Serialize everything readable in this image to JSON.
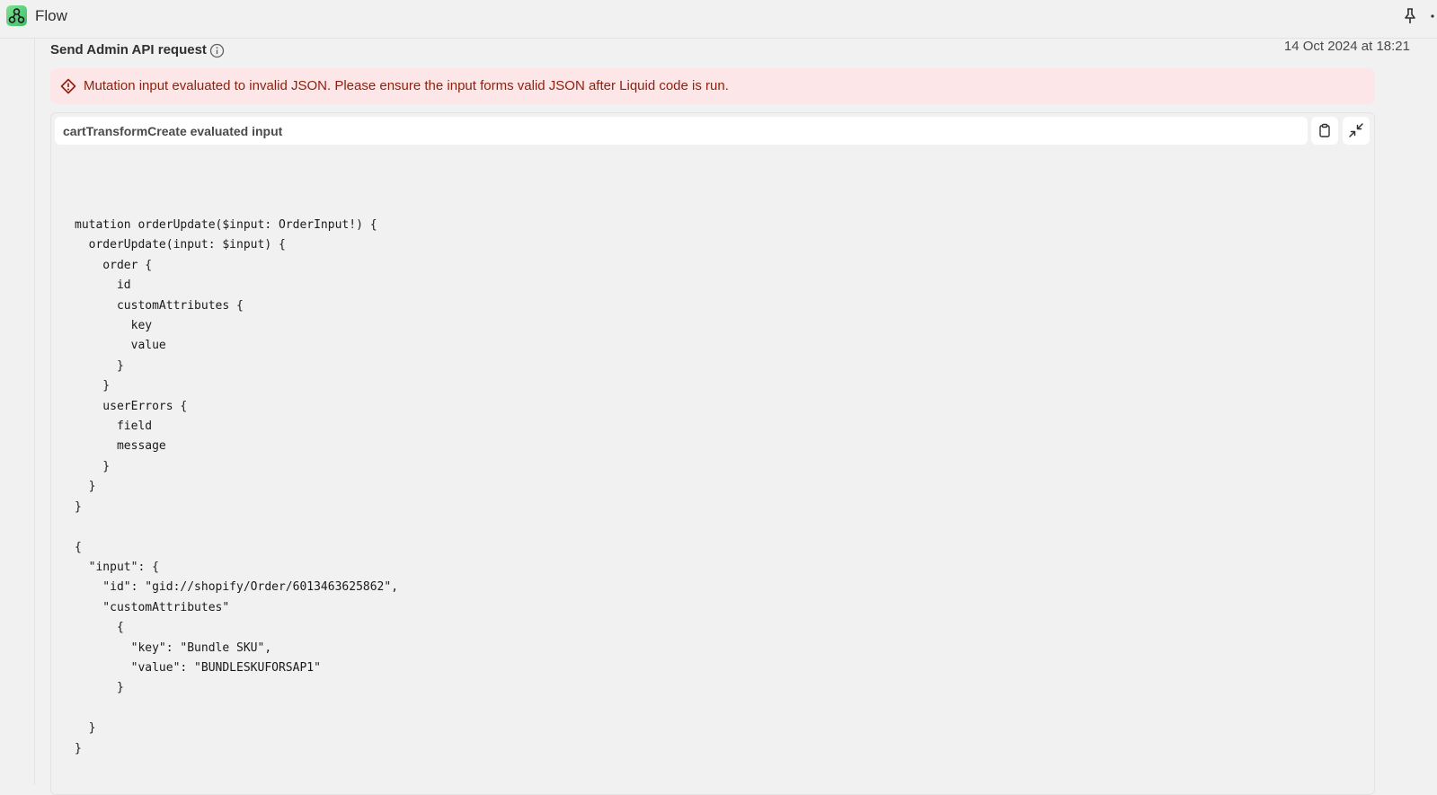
{
  "app": {
    "title": "Flow",
    "icons": {
      "logo": "flow-logo-icon",
      "pin": "pin-icon",
      "more": "more-icon"
    }
  },
  "step": {
    "title": "Send Admin API request",
    "timestamp": "14 Oct 2024 at 18:21"
  },
  "error": {
    "message": "Mutation input evaluated to invalid JSON. Please ensure the input forms valid JSON after Liquid code is run.",
    "color": "#8e1f0b",
    "background": "#fde6e7"
  },
  "code_panel": {
    "title": "cartTransformCreate evaluated input",
    "code": "mutation orderUpdate($input: OrderInput!) {\n  orderUpdate(input: $input) {\n    order {\n      id\n      customAttributes {\n        key\n        value\n      }\n    }\n    userErrors {\n      field\n      message\n    }\n  }\n}\n\n{\n  \"input\": {\n    \"id\": \"gid://shopify/Order/6013463625862\",\n    \"customAttributes\"\n      {\n        \"key\": \"Bundle SKU\",\n        \"value\": \"BUNDLESKUFORSAP1\"\n      }\n\n  }\n}"
  }
}
